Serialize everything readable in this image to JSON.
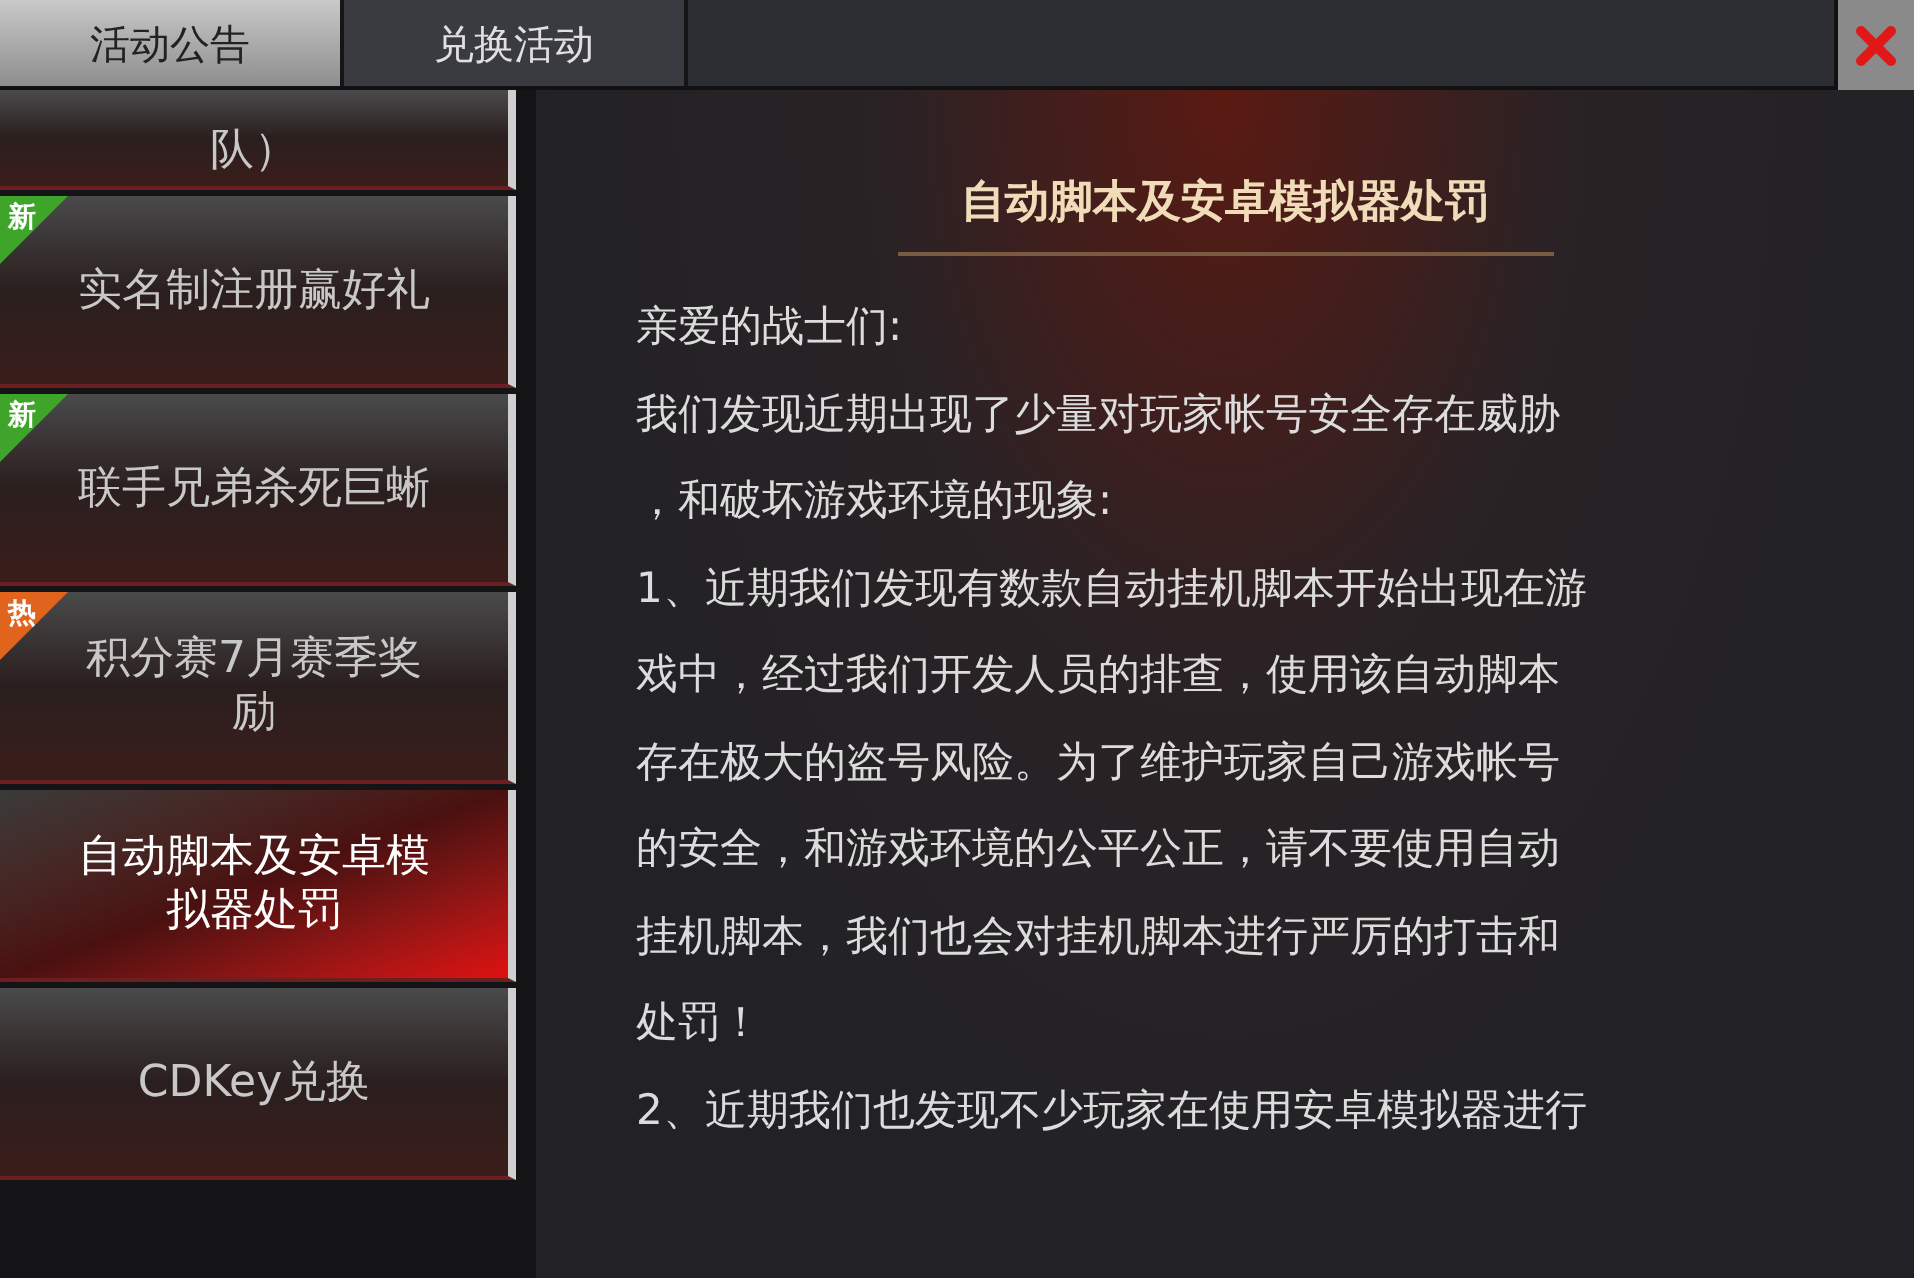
{
  "tabs": [
    {
      "label": "活动公告",
      "selected": true
    },
    {
      "label": "兑换活动",
      "selected": false
    }
  ],
  "sidebar": {
    "items": [
      {
        "label": "队）",
        "selected": false,
        "partial": true
      },
      {
        "label": "实名制注册赢好礼",
        "badge": "新",
        "kind": "new",
        "selected": false
      },
      {
        "label": "联手兄弟杀死巨蜥",
        "badge": "新",
        "kind": "new",
        "selected": false
      },
      {
        "label": "积分赛7月赛季奖励",
        "badge": "热",
        "kind": "hot",
        "selected": false
      },
      {
        "label": "自动脚本及安卓模拟器处罚",
        "selected": true
      },
      {
        "label": "CDKey兑换",
        "selected": false
      }
    ]
  },
  "article": {
    "title": "自动脚本及安卓模拟器处罚",
    "lines": [
      "亲爱的战士们:",
      "我们发现近期出现了少量对玩家帐号安全存在威胁",
      "，和破坏游戏环境的现象:",
      "1、近期我们发现有数款自动挂机脚本开始出现在游",
      "戏中，经过我们开发人员的排查，使用该自动脚本",
      "存在极大的盗号风险。为了维护玩家自己游戏帐号",
      "的安全，和游戏环境的公平公正，请不要使用自动",
      "挂机脚本，我们也会对挂机脚本进行严厉的打击和",
      "处罚！",
      "2、近期我们也发现不少玩家在使用安卓模拟器进行"
    ]
  }
}
